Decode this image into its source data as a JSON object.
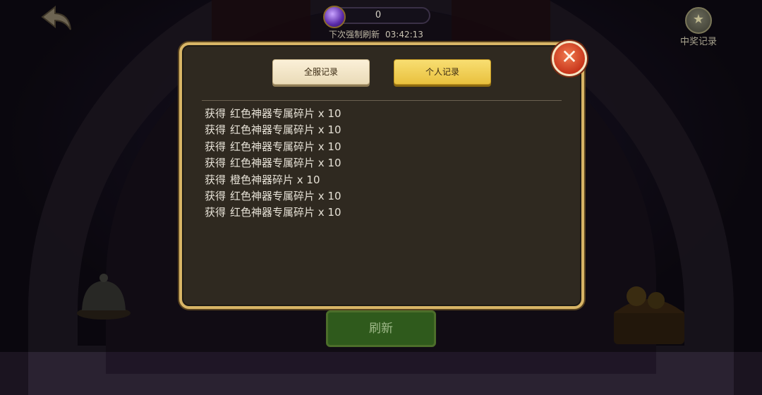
{
  "header": {
    "currency_value": "0",
    "refresh_label": "下次强制刷新",
    "refresh_time": "03:42:13",
    "prize_record_label": "中奖记录"
  },
  "modal": {
    "tabs": [
      {
        "label": "全服记录",
        "active": false
      },
      {
        "label": "个人记录",
        "active": true
      }
    ],
    "records": [
      {
        "verb": "获得",
        "item": "红色神器专属碎片 x 10"
      },
      {
        "verb": "获得",
        "item": "红色神器专属碎片 x 10"
      },
      {
        "verb": "获得",
        "item": "红色神器专属碎片 x 10"
      },
      {
        "verb": "获得",
        "item": "红色神器专属碎片 x 10"
      },
      {
        "verb": "获得",
        "item": "橙色神器碎片 x 10"
      },
      {
        "verb": "获得",
        "item": "红色神器专属碎片 x 10"
      },
      {
        "verb": "获得",
        "item": "红色神器专属碎片 x 10"
      }
    ]
  },
  "footer": {
    "refresh_button_label": "刷新"
  },
  "icons": {
    "back": "back-arrow-icon",
    "currency": "purple-gem-icon",
    "prize": "star-badge-icon",
    "close": "close-icon"
  },
  "colors": {
    "modal_border": "#d8b566",
    "modal_bg": "#2f2920",
    "tab_active": "#f2cf52",
    "tab_inactive": "#f3e6c8",
    "close_button": "#d9482a",
    "record_text": "#e6e1d6"
  }
}
